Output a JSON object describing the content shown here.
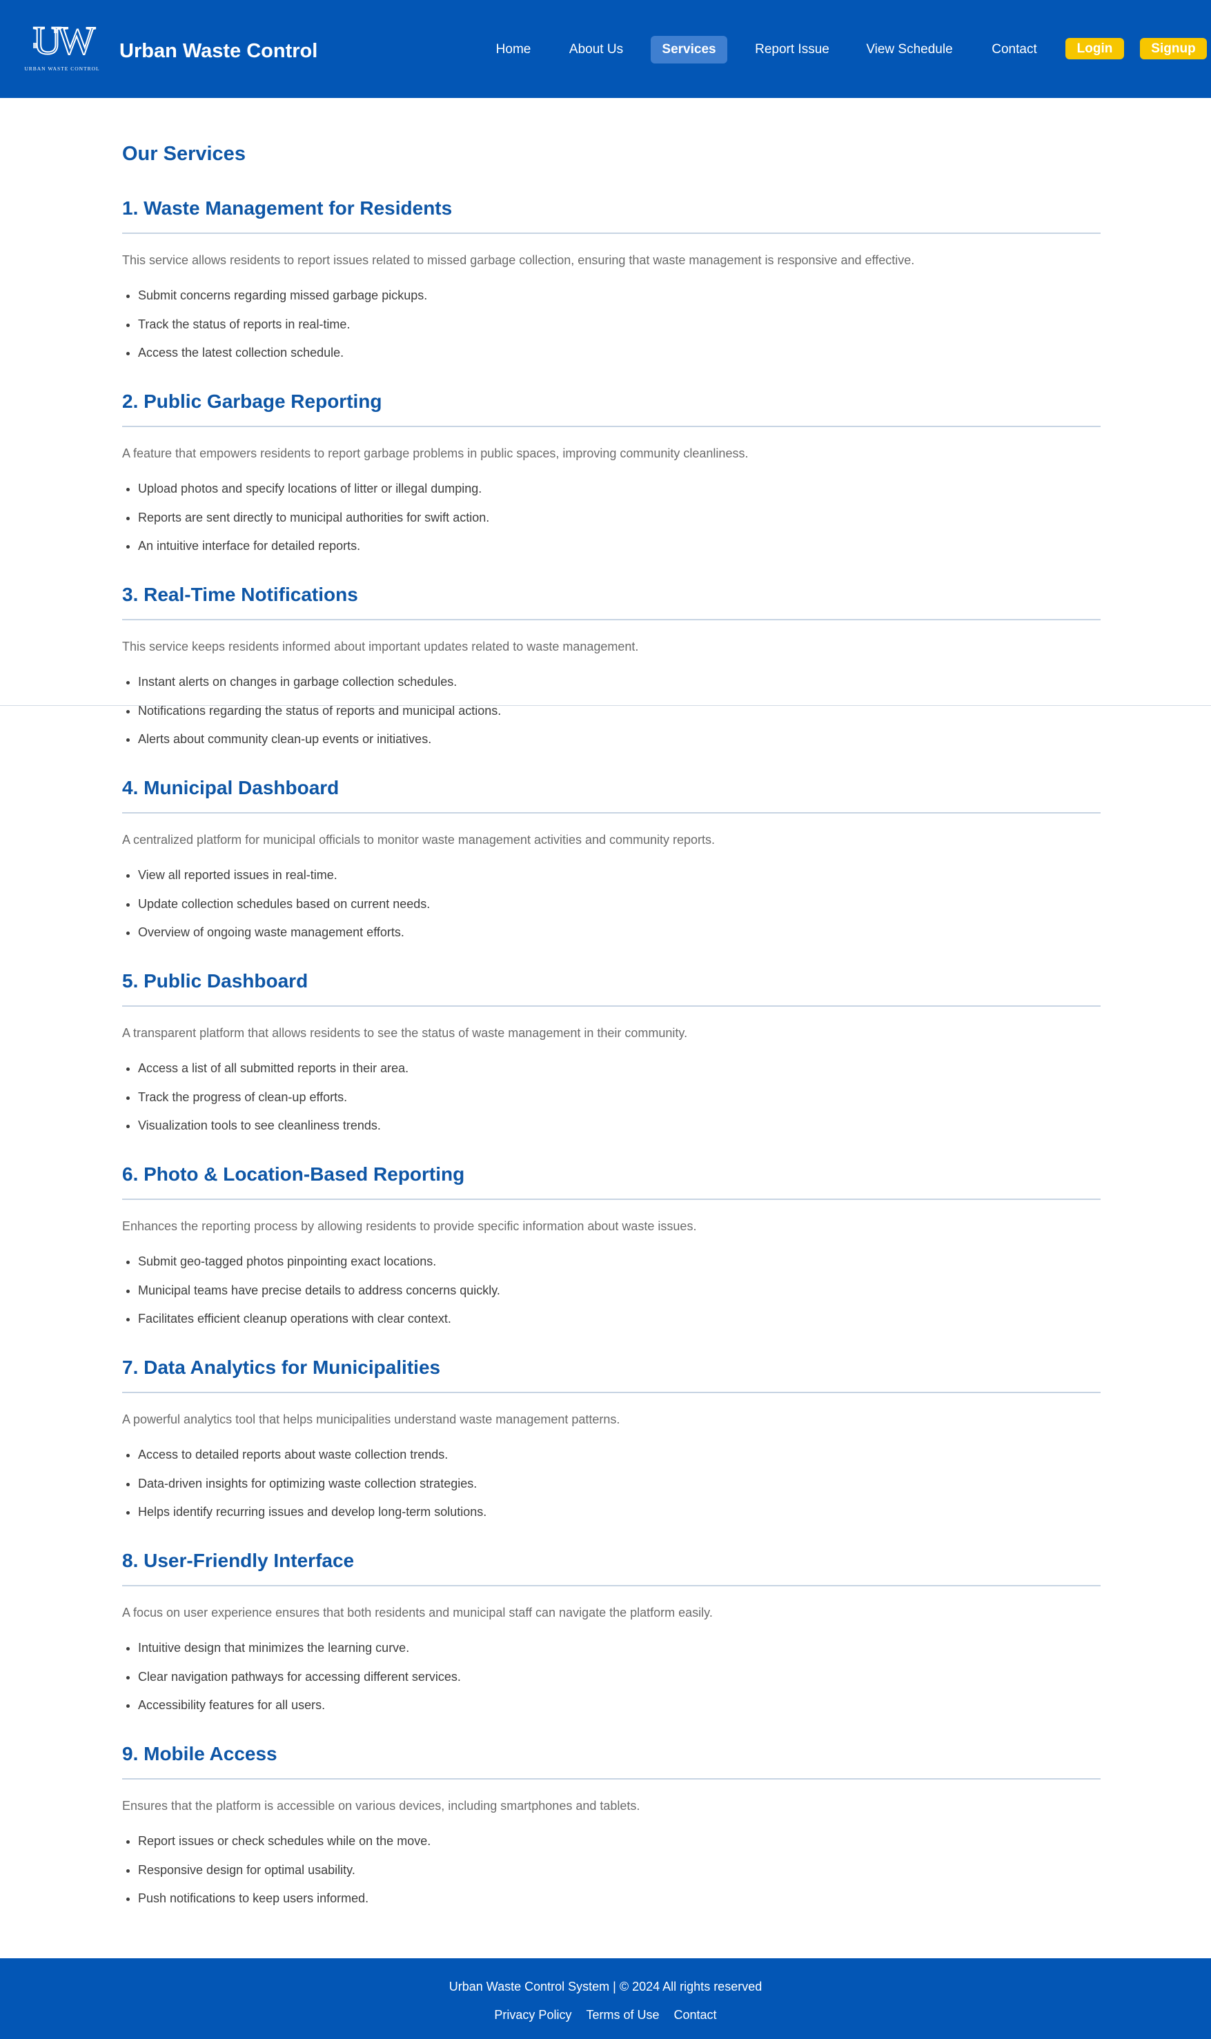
{
  "header": {
    "logo_letters": "UW",
    "logo_caption": "URBAN WASTE CONTROL",
    "brand_name": "Urban Waste Control",
    "nav": {
      "home": "Home",
      "about": "About Us",
      "services": "Services",
      "report": "Report Issue",
      "schedule": "View Schedule",
      "contact": "Contact"
    },
    "login_label": "Login",
    "signup_label": "Signup",
    "colors": {
      "bar": "#0356b5",
      "active_tab": "#3f7fd0",
      "button": "#f7c600"
    }
  },
  "main": {
    "title": "Our Services",
    "sections": [
      {
        "heading": "1. Waste Management for Residents",
        "description": "This service allows residents to report issues related to missed garbage collection, ensuring that waste management is responsive and effective.",
        "items": [
          "Submit concerns regarding missed garbage pickups.",
          "Track the status of reports in real-time.",
          "Access the latest collection schedule."
        ]
      },
      {
        "heading": "2. Public Garbage Reporting",
        "description": "A feature that empowers residents to report garbage problems in public spaces, improving community cleanliness.",
        "items": [
          "Upload photos and specify locations of litter or illegal dumping.",
          "Reports are sent directly to municipal authorities for swift action.",
          "An intuitive interface for detailed reports."
        ]
      },
      {
        "heading": "3. Real-Time Notifications",
        "description": "This service keeps residents informed about important updates related to waste management.",
        "items": [
          "Instant alerts on changes in garbage collection schedules.",
          "Notifications regarding the status of reports and municipal actions.",
          "Alerts about community clean-up events or initiatives."
        ]
      },
      {
        "heading": "4. Municipal Dashboard",
        "description": "A centralized platform for municipal officials to monitor waste management activities and community reports.",
        "items": [
          "View all reported issues in real-time.",
          "Update collection schedules based on current needs.",
          "Overview of ongoing waste management efforts."
        ]
      },
      {
        "heading": "5. Public Dashboard",
        "description": "A transparent platform that allows residents to see the status of waste management in their community.",
        "items": [
          "Access a list of all submitted reports in their area.",
          "Track the progress of clean-up efforts.",
          "Visualization tools to see cleanliness trends."
        ]
      },
      {
        "heading": "6. Photo & Location-Based Reporting",
        "description": "Enhances the reporting process by allowing residents to provide specific information about waste issues.",
        "items": [
          "Submit geo-tagged photos pinpointing exact locations.",
          "Municipal teams have precise details to address concerns quickly.",
          "Facilitates efficient cleanup operations with clear context."
        ]
      },
      {
        "heading": "7. Data Analytics for Municipalities",
        "description": "A powerful analytics tool that helps municipalities understand waste management patterns.",
        "items": [
          "Access to detailed reports about waste collection trends.",
          "Data-driven insights for optimizing waste collection strategies.",
          "Helps identify recurring issues and develop long-term solutions."
        ]
      },
      {
        "heading": "8. User-Friendly Interface",
        "description": "A focus on user experience ensures that both residents and municipal staff can navigate the platform easily.",
        "items": [
          "Intuitive design that minimizes the learning curve.",
          "Clear navigation pathways for accessing different services.",
          "Accessibility features for all users."
        ]
      },
      {
        "heading": "9. Mobile Access",
        "description": "Ensures that the platform is accessible on various devices, including smartphones and tablets.",
        "items": [
          "Report issues or check schedules while on the move.",
          "Responsive design for optimal usability.",
          "Push notifications to keep users informed."
        ]
      }
    ],
    "colors": {
      "heading": "#0e56a6",
      "rule": "#c7d4e3"
    }
  },
  "footer": {
    "copyright": "Urban Waste Control System | © 2024 All rights reserved",
    "links": {
      "privacy": "Privacy Policy",
      "terms": "Terms of Use",
      "contact": "Contact"
    }
  }
}
